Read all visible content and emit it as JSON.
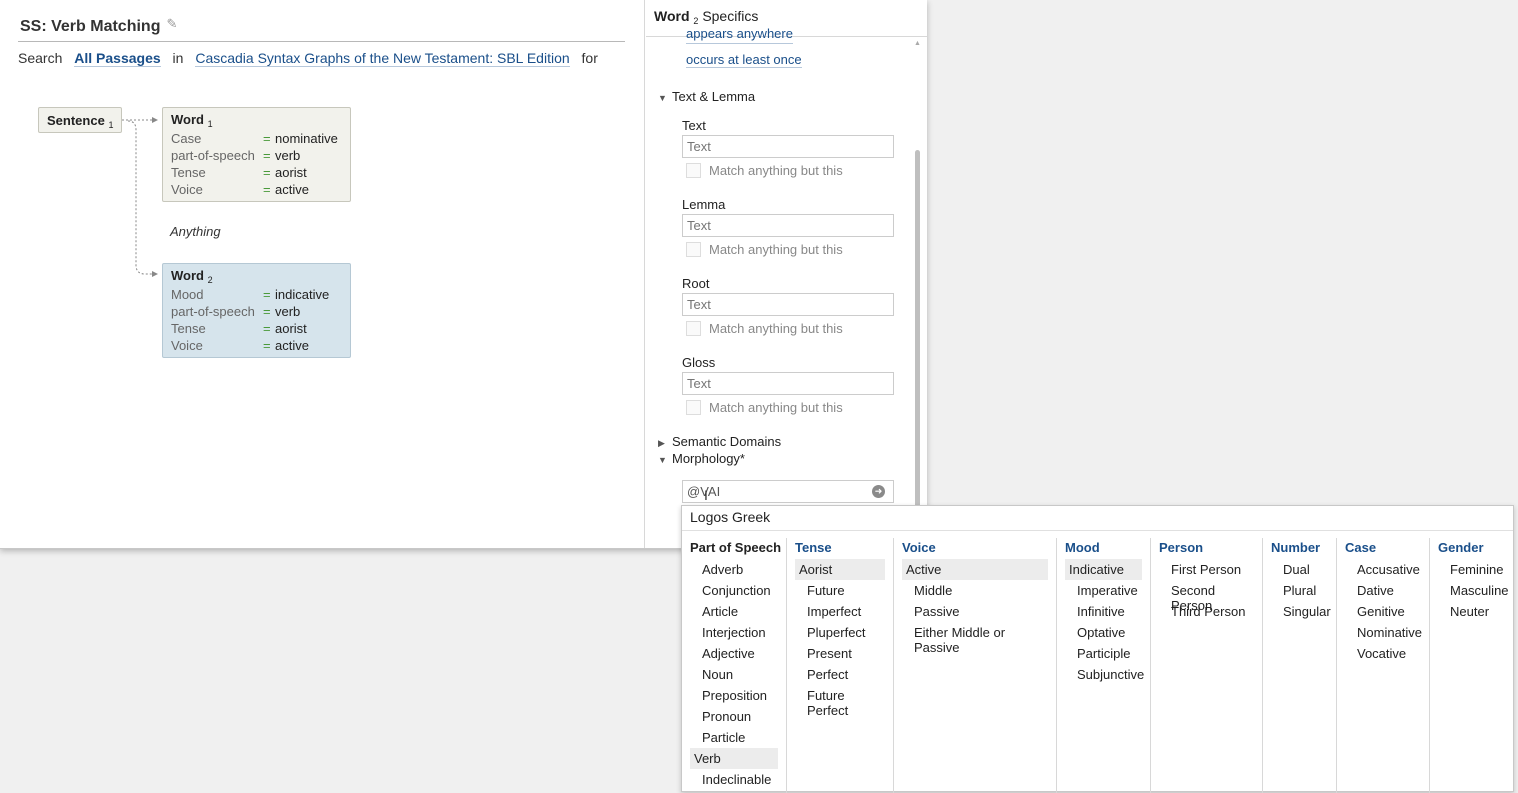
{
  "doc": {
    "title": "SS: Verb Matching",
    "search_label": "Search",
    "scope": "All Passages",
    "in_label": "in",
    "resource": "Cascadia Syntax Graphs of the New Testament: SBL Edition",
    "for_label": "for"
  },
  "graph": {
    "sentence": {
      "label": "Sentence",
      "index": "1"
    },
    "word1": {
      "label": "Word",
      "index": "1",
      "rows": [
        {
          "k": "Case",
          "eq": "=",
          "v": "nominative"
        },
        {
          "k": "part-of-speech",
          "eq": "=",
          "v": "verb"
        },
        {
          "k": "Tense",
          "eq": "=",
          "v": "aorist"
        },
        {
          "k": "Voice",
          "eq": "=",
          "v": "active"
        }
      ]
    },
    "anything": "Anything",
    "word2": {
      "label": "Word",
      "index": "2",
      "rows": [
        {
          "k": "Mood",
          "eq": "=",
          "v": "indicative"
        },
        {
          "k": "part-of-speech",
          "eq": "=",
          "v": "verb"
        },
        {
          "k": "Tense",
          "eq": "=",
          "v": "aorist"
        },
        {
          "k": "Voice",
          "eq": "=",
          "v": "active"
        }
      ]
    }
  },
  "panel": {
    "header_word": "Word",
    "header_index": "2",
    "header_rest": "Specifics",
    "link_appears": "appears anywhere",
    "link_occurs": "occurs at least once",
    "section_text_lemma": "Text & Lemma",
    "fields": [
      {
        "label": "Text",
        "placeholder": "Text",
        "neg": "Match anything but this"
      },
      {
        "label": "Lemma",
        "placeholder": "Text",
        "neg": "Match anything but this"
      },
      {
        "label": "Root",
        "placeholder": "Text",
        "neg": "Match anything but this"
      },
      {
        "label": "Gloss",
        "placeholder": "Text",
        "neg": "Match anything but this"
      }
    ],
    "section_semantic": "Semantic Domains",
    "section_morph": "Morphology*",
    "morph_value": "@VAI"
  },
  "dropdown": {
    "title": "Logos Greek",
    "columns": [
      {
        "header": "Part of Speech",
        "items": [
          "Adverb",
          "Conjunction",
          "Article",
          "Interjection",
          "Adjective",
          "Noun",
          "Preposition",
          "Pronoun",
          "Particle",
          "Verb",
          "Indeclinable"
        ],
        "selected": 9
      },
      {
        "header": "Tense",
        "items": [
          "Aorist",
          "Future",
          "Imperfect",
          "Pluperfect",
          "Present",
          "Perfect",
          "Future Perfect"
        ],
        "selected": 0
      },
      {
        "header": "Voice",
        "items": [
          "Active",
          "Middle",
          "Passive",
          "Either Middle or Passive"
        ],
        "selected": 0
      },
      {
        "header": "Mood",
        "items": [
          "Indicative",
          "Imperative",
          "Infinitive",
          "Optative",
          "Participle",
          "Subjunctive"
        ],
        "selected": 0
      },
      {
        "header": "Person",
        "items": [
          "First Person",
          "Second Person",
          "Third Person"
        ],
        "selected": -1
      },
      {
        "header": "Number",
        "items": [
          "Dual",
          "Plural",
          "Singular"
        ],
        "selected": -1
      },
      {
        "header": "Case",
        "items": [
          "Accusative",
          "Dative",
          "Genitive",
          "Nominative",
          "Vocative"
        ],
        "selected": -1
      },
      {
        "header": "Gender",
        "items": [
          "Feminine",
          "Masculine",
          "Neuter"
        ],
        "selected": -1
      }
    ]
  },
  "colors": {
    "link": "#1a4f8a",
    "equals": "#4a9a3a",
    "word2_bg": "#d6e4ec",
    "node_bg": "#f2f2ec"
  }
}
